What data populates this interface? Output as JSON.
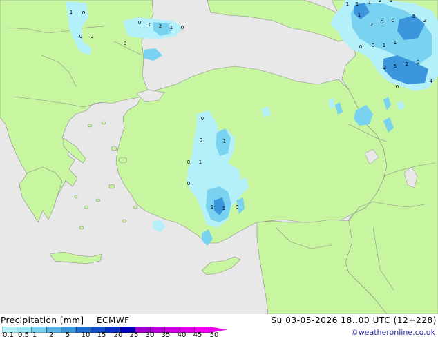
{
  "footer": {
    "title": "Precipitation [mm]",
    "model": "ECMWF",
    "valid_time": "Su 03-05-2026 18..00 UTC (12+228)",
    "credit": "©weatheronline.co.uk"
  },
  "legend": {
    "ticks": [
      "0.1",
      "0.5",
      "1",
      "2",
      "5",
      "10",
      "15",
      "20",
      "25",
      "30",
      "35",
      "40",
      "45",
      "50"
    ],
    "colors": [
      "#b4f0fa",
      "#96e6f5",
      "#78d2f0",
      "#5ab4e6",
      "#3c96dc",
      "#1e6ed2",
      "#1450c8",
      "#0a32be",
      "#0000b4",
      "#a000c8",
      "#b400d2",
      "#c800dc",
      "#dc00e6",
      "#f000f0"
    ]
  },
  "map": {
    "colors": {
      "sea": "#e8e8e8",
      "land": "#c8f5a0",
      "border": "#9a9a9a",
      "rain_light": "#b4f0fa",
      "rain_mid": "#78d2f0",
      "rain_heavy": "#3c96dc"
    },
    "cell_labels": [
      "1",
      "0",
      "0",
      "0",
      "0",
      "0",
      "1",
      "2",
      "1",
      "0",
      "1",
      "1",
      "1",
      "2",
      "1",
      "1",
      "2",
      "0",
      "0",
      "5",
      "2",
      "0",
      "0",
      "1",
      "1",
      "2",
      "5",
      "2",
      "0",
      "0",
      "4",
      "0",
      "0",
      "1",
      "0",
      "1",
      "0",
      "1",
      "1",
      "0"
    ]
  }
}
